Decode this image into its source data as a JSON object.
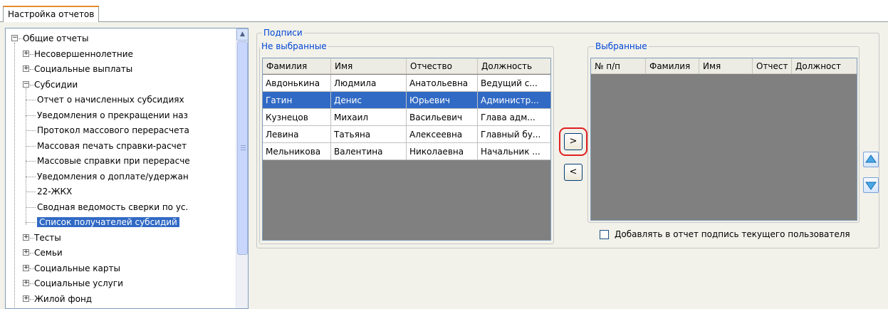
{
  "tab": {
    "label": "Настройка отчетов"
  },
  "tree": {
    "nodes": [
      {
        "label": "Общие отчеты",
        "toggle": "−",
        "level": 0
      },
      {
        "label": "Несовершеннолетние",
        "toggle": "+",
        "level": 1
      },
      {
        "label": "Социальные выплаты",
        "toggle": "+",
        "level": 1
      },
      {
        "label": "Субсидии",
        "toggle": "−",
        "level": 1
      },
      {
        "label": "Отчет о начисленных субсидиях",
        "level": 2
      },
      {
        "label": "Уведомления о прекращении наз",
        "level": 2
      },
      {
        "label": "Протокол массового перерасчета",
        "level": 2
      },
      {
        "label": "Массовая печать справки-расчет",
        "level": 2
      },
      {
        "label": "Массовые справки при перерасче",
        "level": 2
      },
      {
        "label": "Уведомления о доплате/удержан",
        "level": 2
      },
      {
        "label": "22-ЖКХ",
        "level": 2
      },
      {
        "label": "Сводная ведомость сверки по ус.",
        "level": 2
      },
      {
        "label": "Список получателей субсидий",
        "level": 2,
        "selected": true
      },
      {
        "label": "Тесты",
        "toggle": "+",
        "level": 1
      },
      {
        "label": "Семьи",
        "toggle": "+",
        "level": 1
      },
      {
        "label": "Социальные карты",
        "toggle": "+",
        "level": 1
      },
      {
        "label": "Социальные услуги",
        "toggle": "+",
        "level": 1
      },
      {
        "label": "Жилой фонд",
        "toggle": "+",
        "level": 1
      }
    ]
  },
  "signatures": {
    "group_title": "Подписи",
    "unselected": {
      "title": "Не выбранные",
      "columns": [
        "Фамилия",
        "Имя",
        "Отчество",
        "Должность"
      ],
      "rows": [
        [
          "Авдонькина",
          "Людмила",
          "Анатольевна",
          "Ведущий с..."
        ],
        [
          "Гатин",
          "Денис",
          "Юрьевич",
          "Администр..."
        ],
        [
          "Кузнецов",
          "Михаил",
          "Васильевич",
          "Глава адм..."
        ],
        [
          "Левина",
          "Татьяна",
          "Алексеевна",
          "Главный бу..."
        ],
        [
          "Мельникова",
          "Валентина",
          "Николаевна",
          "Начальник ..."
        ]
      ],
      "selected_row": 1
    },
    "move_right_label": ">",
    "move_left_label": "<",
    "selected": {
      "title": "Выбранные",
      "columns": [
        "№ п/п",
        "Фамилия",
        "Имя",
        "Отчест",
        "Должност"
      ]
    },
    "add_current_user_label": "Добавлять в отчет подпись текущего пользователя",
    "add_current_user_checked": false
  },
  "colors": {
    "selection": "#316ac5",
    "group_title": "#0046d5",
    "highlight": "#e02020"
  }
}
